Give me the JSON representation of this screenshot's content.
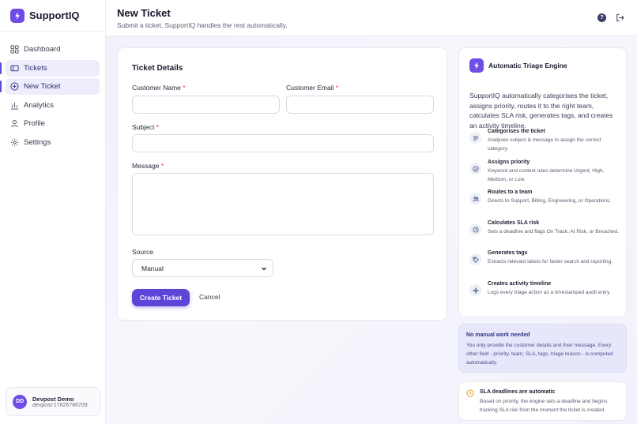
{
  "app": {
    "name": "SupportIQ"
  },
  "sidebar": {
    "items": [
      {
        "label": "Dashboard",
        "icon": "grid-icon",
        "active": false
      },
      {
        "label": "Tickets",
        "icon": "ticket-icon",
        "active": true
      },
      {
        "label": "New Ticket",
        "icon": "plus-circle-icon",
        "active": true
      },
      {
        "label": "Analytics",
        "icon": "bar-chart-icon",
        "active": false
      },
      {
        "label": "Profile",
        "icon": "user-icon",
        "active": false
      },
      {
        "label": "Settings",
        "icon": "gear-icon",
        "active": false
      }
    ],
    "user": {
      "initials": "DD",
      "name": "Devpost Demo",
      "email": "devpost-17826786709"
    }
  },
  "header": {
    "title": "New Ticket",
    "subtitle": "Submit a ticket. SupportIQ handles the rest automatically."
  },
  "form": {
    "card_title": "Ticket Details",
    "customer_name_label": "Customer Name",
    "customer_email_label": "Customer Email",
    "subject_label": "Subject",
    "message_label": "Message",
    "required_marker": "*",
    "source_label": "Source",
    "source_value": "Manual",
    "submit_label": "Create Ticket",
    "cancel_label": "Cancel"
  },
  "engine": {
    "title": "Automatic Triage Engine",
    "description": "SupportIQ automatically categorises the ticket, assigns priority, routes it to the right team, calculates SLA risk, generates tags, and creates an activity timeline.",
    "features": [
      {
        "icon": "list-icon",
        "title": "Categorises the ticket",
        "desc": "Analyses subject & message to assign the correct category."
      },
      {
        "icon": "shield-check-icon",
        "title": "Assigns priority",
        "desc": "Keyword and context rules determine Urgent, High, Medium, or Low."
      },
      {
        "icon": "users-icon",
        "title": "Routes to a team",
        "desc": "Directs to Support, Billing, Engineering, or Operations."
      },
      {
        "icon": "clock-icon",
        "title": "Calculates SLA risk",
        "desc": "Sets a deadline and flags On Track, At Risk, or Breached."
      },
      {
        "icon": "tag-icon",
        "title": "Generates tags",
        "desc": "Extracts relevant labels for faster search and reporting."
      },
      {
        "icon": "sparkle-icon",
        "title": "Creates activity timeline",
        "desc": "Logs every triage action as a timestamped audit entry."
      }
    ]
  },
  "notice": {
    "title": "No manual work needed",
    "desc": "You only provide the customer details and their message. Every other field - priority, team, SLA, tags, triage reason - is computed automatically."
  },
  "sla_note": {
    "title": "SLA deadlines are automatic",
    "desc": "Based on priority, the engine sets a deadline and begins tracking SLA risk from the moment the ticket is created."
  },
  "colors": {
    "accent": "#5d45d8",
    "brand": "#6d4ce8",
    "required": "#e0364a",
    "sla_warning": "#e8a317"
  }
}
